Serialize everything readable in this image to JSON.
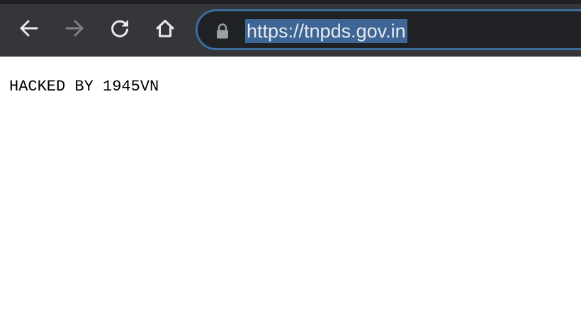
{
  "browser": {
    "url": "https://tnpds.gov.in",
    "icons": {
      "back": "arrow-left-icon",
      "forward": "arrow-right-icon",
      "reload": "reload-icon",
      "home": "home-icon",
      "lock": "lock-icon"
    },
    "colors": {
      "toolbar": "#35363a",
      "omnibox": "#202124",
      "omnibox_focus_border": "#3b6d9f",
      "url_selection": "#3d6595"
    }
  },
  "page": {
    "text": "HACKED BY 1945VN"
  }
}
